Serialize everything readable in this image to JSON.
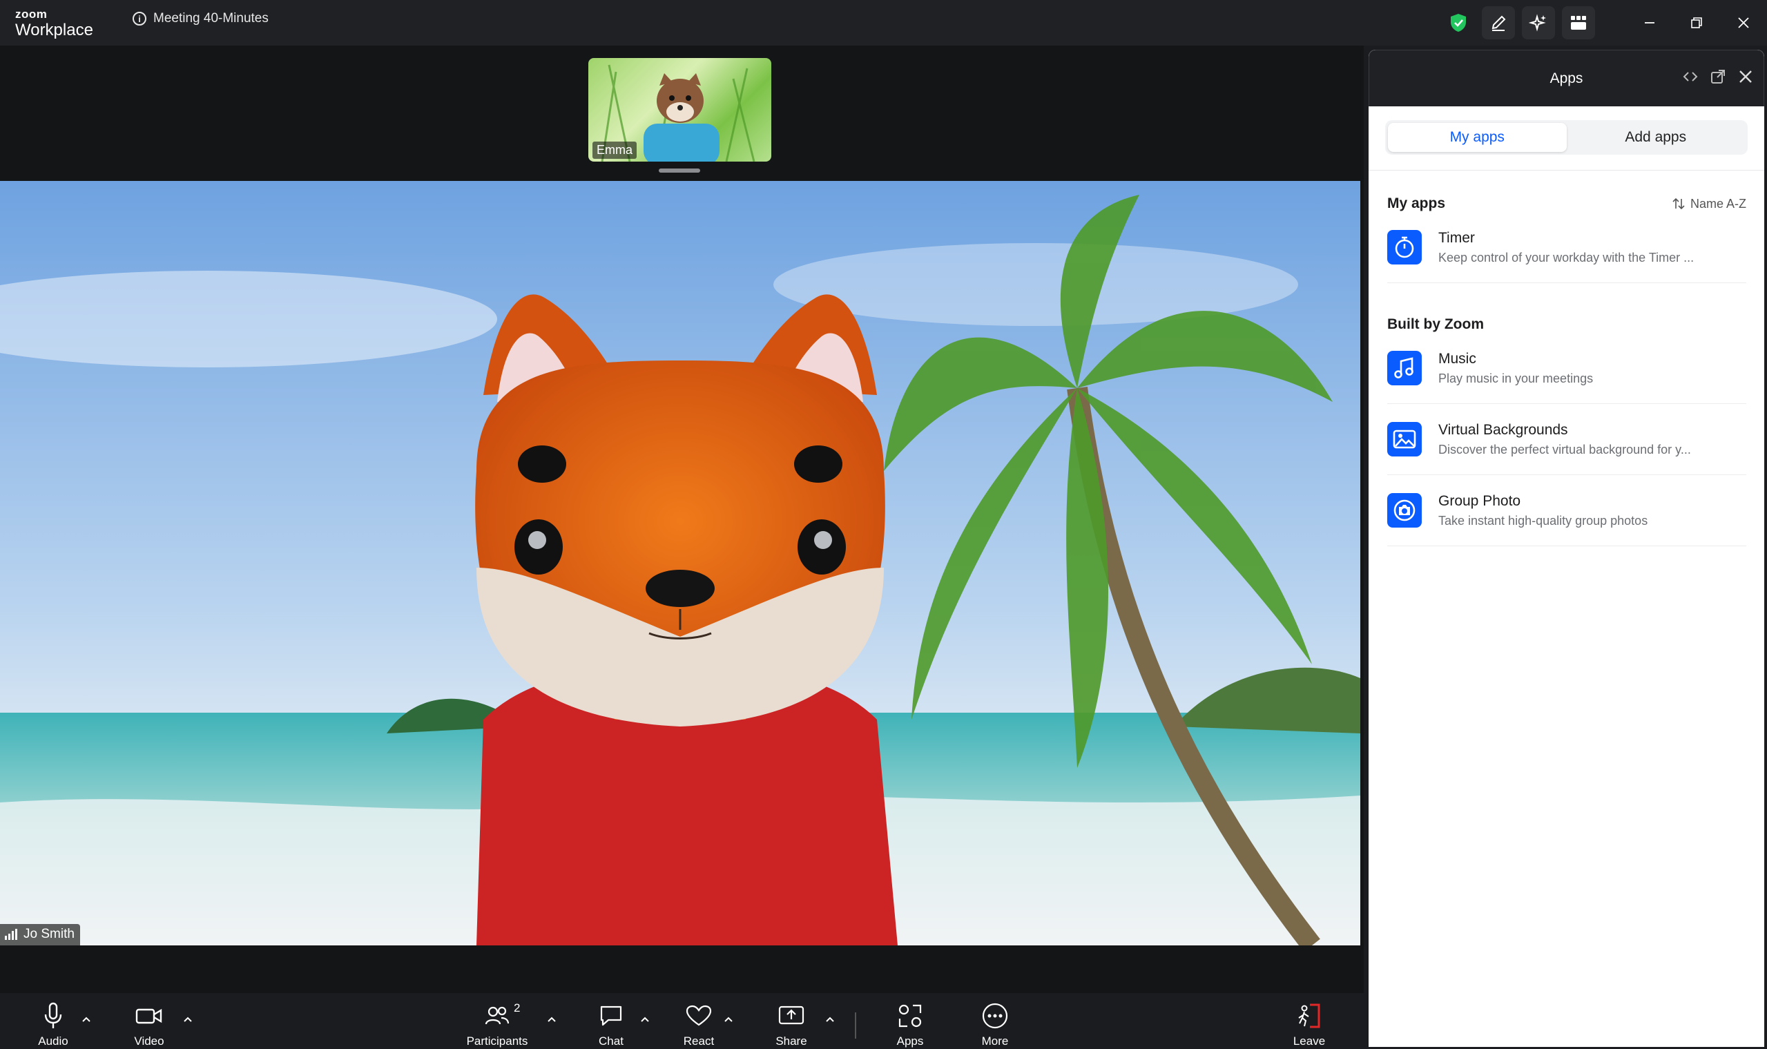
{
  "titlebar": {
    "brand_top": "zoom",
    "brand_bottom": "Workplace",
    "meeting_title": "Meeting 40-Minutes",
    "icons": [
      "shield-check-icon",
      "pencil-icon",
      "sparkle-icon",
      "grid-icon"
    ],
    "window_controls": [
      "minimize-icon",
      "restore-icon",
      "close-icon"
    ]
  },
  "stage": {
    "thumbnail_name": "Emma",
    "main_name": "Jo Smith"
  },
  "toolbar": {
    "audio": "Audio",
    "video": "Video",
    "participants": "Participants",
    "participants_count": "2",
    "chat": "Chat",
    "react": "React",
    "share": "Share",
    "apps": "Apps",
    "more": "More",
    "leave": "Leave"
  },
  "apps_panel": {
    "title": "Apps",
    "tabs": [
      {
        "label": "My apps",
        "active": true
      },
      {
        "label": "Add apps",
        "active": false
      }
    ],
    "my_apps_title": "My apps",
    "sort_label": "Name A-Z",
    "my_apps": [
      {
        "name": "Timer",
        "description": "Keep control of your workday with the Timer ...",
        "icon": "timer-icon"
      }
    ],
    "built_title": "Built by Zoom",
    "built_apps": [
      {
        "name": "Music",
        "description": "Play music in your meetings",
        "icon": "music-note-icon"
      },
      {
        "name": "Virtual Backgrounds",
        "description": "Discover the perfect virtual background for y...",
        "icon": "landscape-icon"
      },
      {
        "name": "Group Photo",
        "description": "Take instant high-quality group photos",
        "icon": "camera-icon"
      }
    ]
  },
  "colors": {
    "accent": "#0b5cff",
    "titlebar": "#202124",
    "leave": "#e02828",
    "shield": "#22c55e"
  }
}
